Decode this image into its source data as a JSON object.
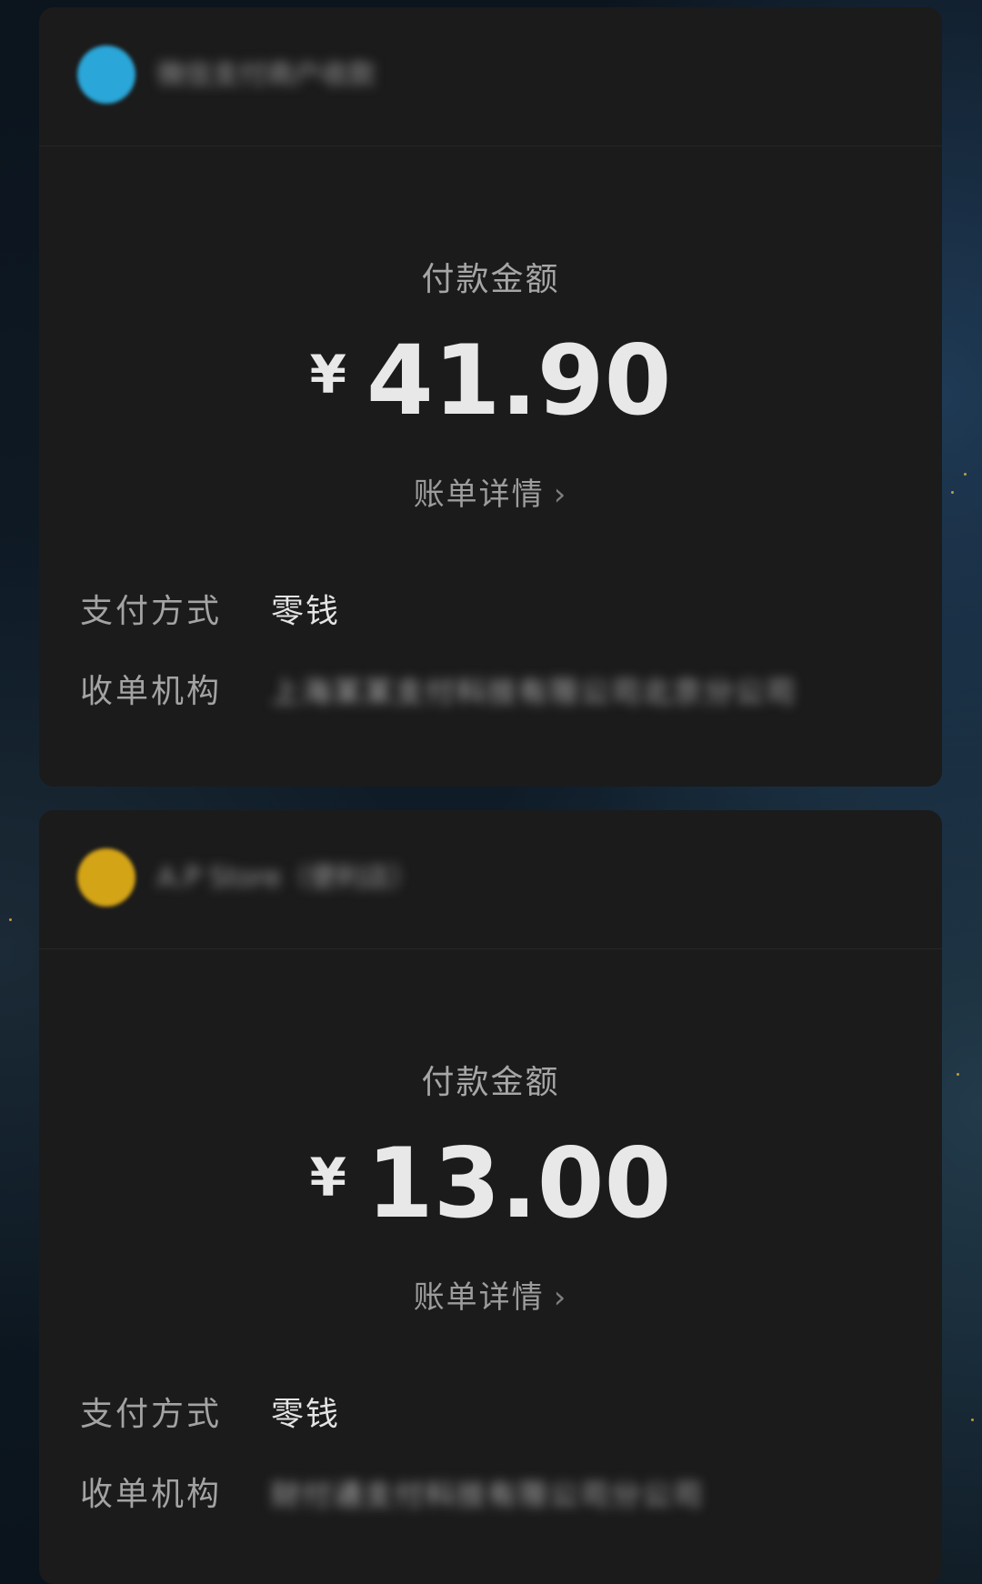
{
  "transactions": [
    {
      "merchant": {
        "name": "微信支付商户收款",
        "avatar_color": "#2aa6d8"
      },
      "amount_label": "付款金额",
      "currency_symbol": "¥",
      "amount": "41.90",
      "detail_link": "账单详情",
      "chevron": "›",
      "payment_method_label": "支付方式",
      "payment_method": "零钱",
      "acquirer_label": "收单机构",
      "acquirer": "上海某某支付科技有限公司北京分公司"
    },
    {
      "merchant": {
        "name": "A.P Store（便利店）",
        "avatar_color": "#d4a417"
      },
      "amount_label": "付款金额",
      "currency_symbol": "¥",
      "amount": "13.00",
      "detail_link": "账单详情",
      "chevron": "›",
      "payment_method_label": "支付方式",
      "payment_method": "零钱",
      "acquirer_label": "收单机构",
      "acquirer": "财付通支付科技有限公司分公司"
    }
  ],
  "colors": {
    "card_background": "#1b1b1b",
    "amount_text": "#e8e8e8",
    "label_text": "#a6a6a6"
  }
}
